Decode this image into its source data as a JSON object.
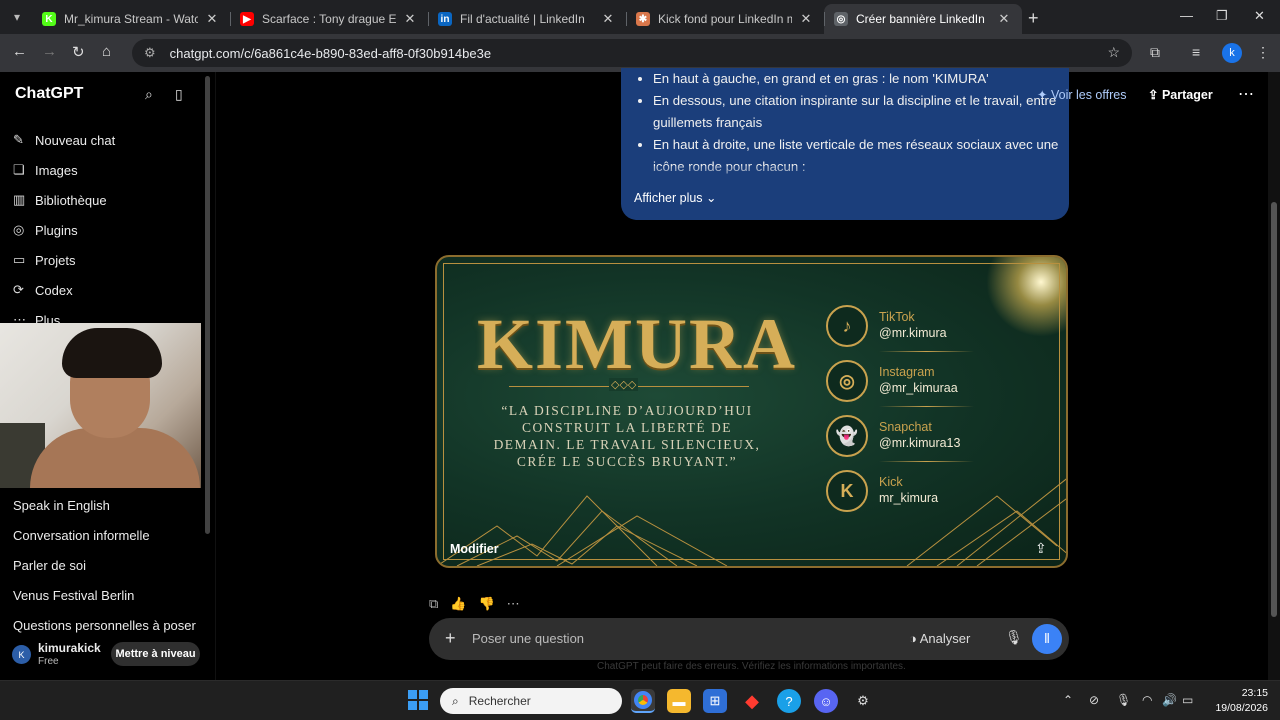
{
  "browser": {
    "tabs": [
      {
        "title": "Mr_kimura Stream - Watch Live",
        "favicon": "K",
        "color": "#53fc18",
        "active": false
      },
      {
        "title": "Scarface : Tony drague Elvira Cl",
        "favicon": "▶",
        "color": "#ff0000",
        "active": false
      },
      {
        "title": "Fil d'actualité | LinkedIn",
        "favicon": "in",
        "color": "#0a66c2",
        "active": false
      },
      {
        "title": "Kick fond pour LinkedIn mr_kim",
        "favicon": "✱",
        "color": "#d9774b",
        "active": false
      },
      {
        "title": "Créer bannière LinkedIn",
        "favicon": "◎",
        "color": "#5f6368",
        "active": true
      }
    ],
    "url": "chatgpt.com/c/6a861c4e-b890-83ed-aff8-0f30b914be3e",
    "profile_initial": "k"
  },
  "sidebar": {
    "brand": "ChatGPT",
    "nav": [
      {
        "label": "Nouveau chat",
        "icon": "✎"
      },
      {
        "label": "Images",
        "icon": "❏"
      },
      {
        "label": "Bibliothèque",
        "icon": "▥"
      },
      {
        "label": "Plugins",
        "icon": "◎"
      },
      {
        "label": "Projets",
        "icon": "▭"
      },
      {
        "label": "Codex",
        "icon": "⟳"
      },
      {
        "label": "Plus",
        "icon": "⋯"
      }
    ],
    "history": [
      "Speak in English",
      "Conversation informelle",
      "Parler de soi",
      "Venus Festival Berlin",
      "Questions personnelles à poser"
    ],
    "user": {
      "initial": "K",
      "name": "kimurakick",
      "plan": "Free",
      "upgrade_label": "Mettre à niveau"
    }
  },
  "header": {
    "offers_label": "Voir les offres",
    "share_label": "Partager"
  },
  "message": {
    "bullets": [
      "En haut à gauche, en grand et en gras : le nom 'KIMURA'",
      "En dessous, une citation inspirante sur la discipline et le travail, entre guillemets français",
      "En haut à droite, une liste verticale de mes réseaux sociaux avec une icône ronde pour chacun :"
    ],
    "show_more": "Afficher plus"
  },
  "banner": {
    "title": "KIMURA",
    "quote": "“LA DISCIPLINE D’AUJOURD’HUI CONSTRUIT LA LIBERTÉ DE DEMAIN. LE TRAVAIL SILENCIEUX, CRÉE LE SUCCÈS BRUYANT.”",
    "socials": [
      {
        "network": "TikTok",
        "handle": "@mr.kimura",
        "icon": "♪"
      },
      {
        "network": "Instagram",
        "handle": "@mr_kimuraa",
        "icon": "◎"
      },
      {
        "network": "Snapchat",
        "handle": "@mr.kimura13",
        "icon": "👻"
      },
      {
        "network": "Kick",
        "handle": "mr_kimura",
        "icon": "K"
      }
    ],
    "edit_label": "Modifier"
  },
  "composer": {
    "placeholder": "Poser une question",
    "analyze_label": "Analyser",
    "disclaimer": "ChatGPT peut faire des erreurs. Vérifiez les informations importantes."
  },
  "taskbar": {
    "search_placeholder": "Rechercher",
    "time": "23:15",
    "date": "19/08/2026"
  }
}
